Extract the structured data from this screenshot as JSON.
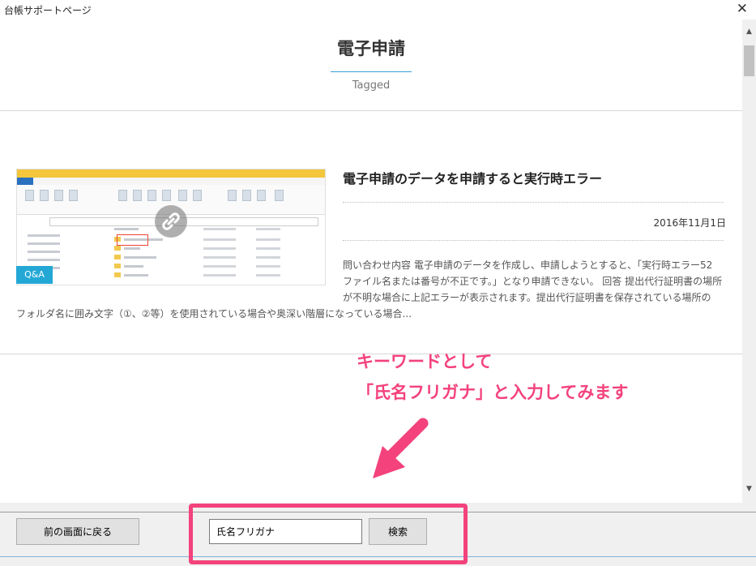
{
  "window": {
    "title": "台帳サポートページ",
    "close_glyph": "✕"
  },
  "page": {
    "title": "電子申請",
    "subtitle": "Tagged"
  },
  "post": {
    "badge": "Q&A",
    "title": "電子申請のデータを申請すると実行時エラー",
    "date": "2016年11月1日",
    "excerpt_lines": [
      "問い合わせ内容 電子申請のデータを作成し、申請しようとすると、「実行時エラー52",
      "ファイル名または番号が不正です。」となり申請できない。 回答 提出代行証明書の場所",
      "が不明な場合に上記エラーが表示されます。提出代行証明書を保存されている場所の",
      "フォルダ名に囲み文字（①、②等）を使用されている場合や奥深い階層になっている場合..."
    ]
  },
  "annotation": {
    "line1": "キーワードとして",
    "line2": "「氏名フリガナ」と入力してみます",
    "color": "#f3427c"
  },
  "footer": {
    "back_label": "前の画面に戻る",
    "search_value": "氏名フリガナ",
    "search_label": "検索"
  },
  "icons": {
    "link": "link-icon",
    "scroll_up": "▲",
    "scroll_down": "▼"
  },
  "colors": {
    "accent_rule": "#3aa0d8",
    "badge_bg": "#23a8d6"
  }
}
